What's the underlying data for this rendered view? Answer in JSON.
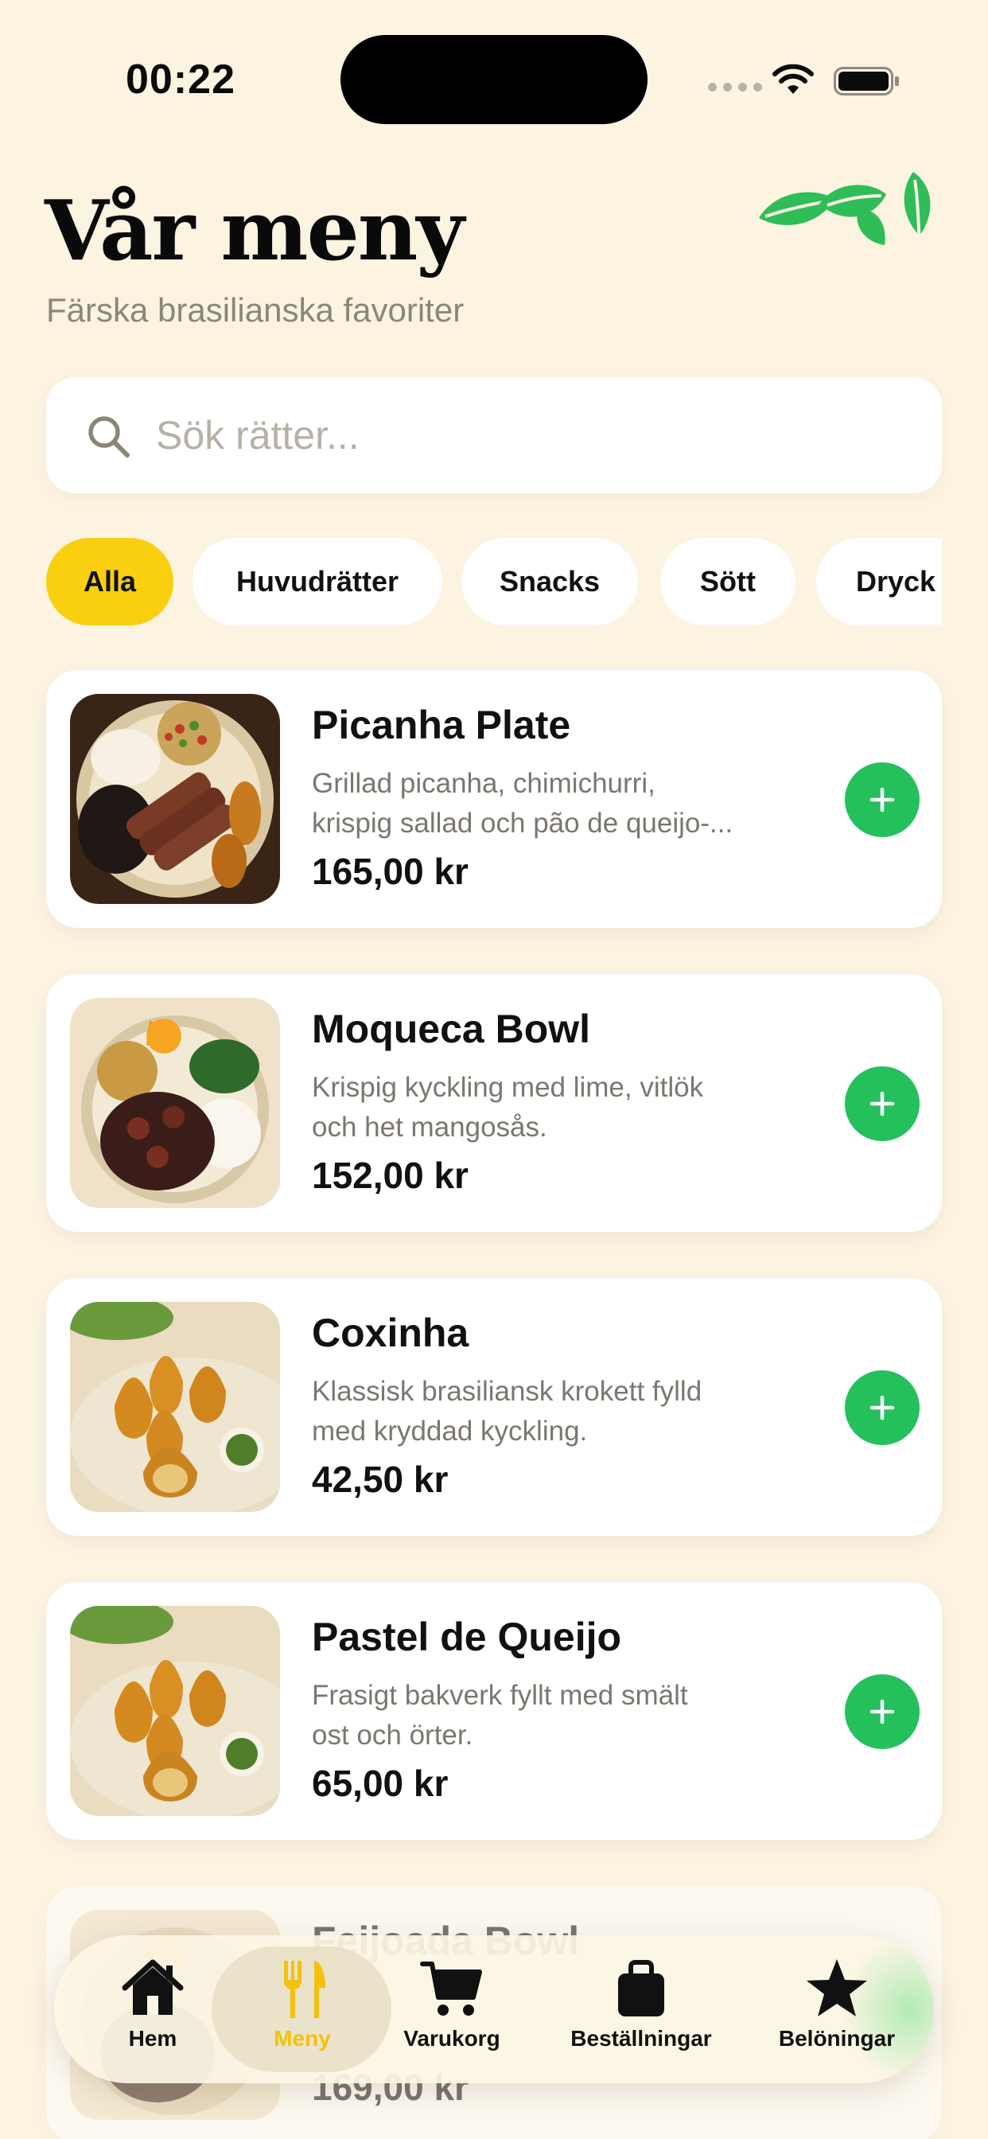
{
  "status_bar": {
    "time": "00:22"
  },
  "header": {
    "title": "Vår meny",
    "subtitle": "Färska brasilianska favoriter"
  },
  "search": {
    "placeholder": "Sök rätter...",
    "value": ""
  },
  "categories": [
    {
      "label": "Alla",
      "active": true
    },
    {
      "label": "Huvudrätter",
      "active": false
    },
    {
      "label": "Snacks",
      "active": false
    },
    {
      "label": "Sött",
      "active": false
    },
    {
      "label": "Dryck",
      "active": false
    }
  ],
  "menu_items": [
    {
      "name": "Picanha Plate",
      "desc_line1": "Grillad picanha, chimichurri,",
      "desc_line2": "krispig sallad och pão de queijo-...",
      "price": "165,00 kr"
    },
    {
      "name": "Moqueca Bowl",
      "desc_line1": "Krispig kyckling med lime, vitlök",
      "desc_line2": "och het mangosås.",
      "price": "152,00 kr"
    },
    {
      "name": "Coxinha",
      "desc_line1": "Klassisk brasiliansk krokett fylld",
      "desc_line2": "med kryddad kyckling.",
      "price": "42,50 kr"
    },
    {
      "name": "Pastel de Queijo",
      "desc_line1": "Frasigt bakverk fyllt med smält",
      "desc_line2": "ost och örter.",
      "price": "65,00 kr"
    },
    {
      "name": "Feijoada Bowl",
      "desc_line1": "",
      "desc_line2": "",
      "price": "169,00 kr"
    }
  ],
  "tab_bar": {
    "tabs": [
      {
        "label": "Hem",
        "icon": "house-icon",
        "active": false
      },
      {
        "label": "Meny",
        "icon": "fork-knife-icon",
        "active": true
      },
      {
        "label": "Varukorg",
        "icon": "cart-icon",
        "active": false
      },
      {
        "label": "Beställningar",
        "icon": "bag-icon",
        "active": false
      },
      {
        "label": "Belöningar",
        "icon": "star-icon",
        "active": false
      }
    ]
  },
  "colors": {
    "background": "#fcf3e1",
    "accent_yellow": "#f9cf0f",
    "accent_green": "#24c05c",
    "muted_text": "#7b776f"
  }
}
